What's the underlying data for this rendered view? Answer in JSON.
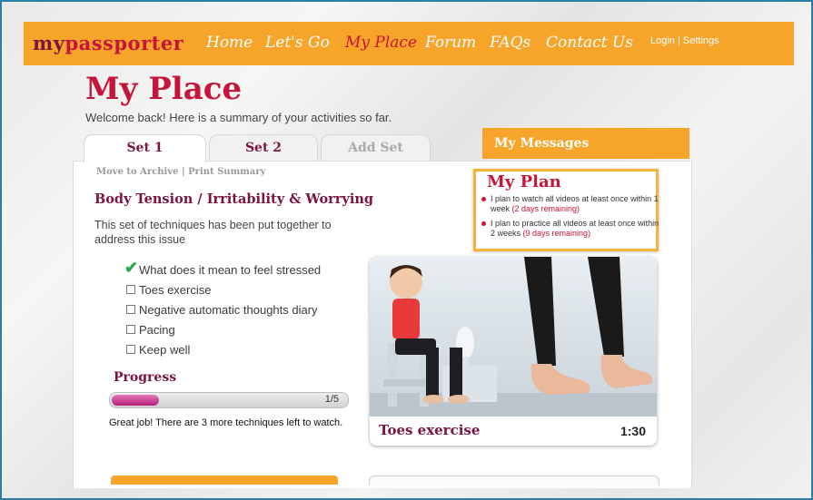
{
  "nav": {
    "logo_part1": "my",
    "logo_part2": "passporter",
    "links": [
      "Home",
      "Let's Go",
      "My Place",
      "Forum",
      "FAQs",
      "Contact Us"
    ],
    "active_link": "My Place",
    "login": "Login | Settings"
  },
  "page": {
    "title": "My Place",
    "welcome": "Welcome back! Here is a summary of your activities so far."
  },
  "tabs": [
    "Set 1",
    "Set 2",
    "Add Set"
  ],
  "set": {
    "actions": "Move to Archive | Print Summary",
    "title": "Body Tension / Irritability & Worrying",
    "description": "This set of techniques has been put together to address this issue",
    "techniques": [
      {
        "label": "What does it mean to feel stressed",
        "done": true
      },
      {
        "label": "Toes exercise",
        "done": false
      },
      {
        "label": "Negative automatic thoughts diary",
        "done": false
      },
      {
        "label": "Pacing",
        "done": false
      },
      {
        "label": "Keep well",
        "done": false
      }
    ],
    "progress_label": "Progress",
    "progress_fraction": 0.2,
    "progress_text": "1/5",
    "encouragement": "Great job! There are 3 more techniques left to watch."
  },
  "messages": {
    "tab_label": "My Messages"
  },
  "plan": {
    "title": "My Plan",
    "items": [
      {
        "text": "I plan to watch all videos  at least once within 1 week ",
        "remaining": "(2 days remaining)"
      },
      {
        "text": "I plan to practice all videos at least once within 2 weeks ",
        "remaining": "(9 days remaining)"
      }
    ]
  },
  "video": {
    "title": "Toes exercise",
    "duration": "1:30"
  },
  "colors": {
    "orange": "#f7a52a",
    "maroon": "#7a1440",
    "red": "#c8143a",
    "check_green": "#2aa84a",
    "progress_pink": "#b51e7a"
  }
}
